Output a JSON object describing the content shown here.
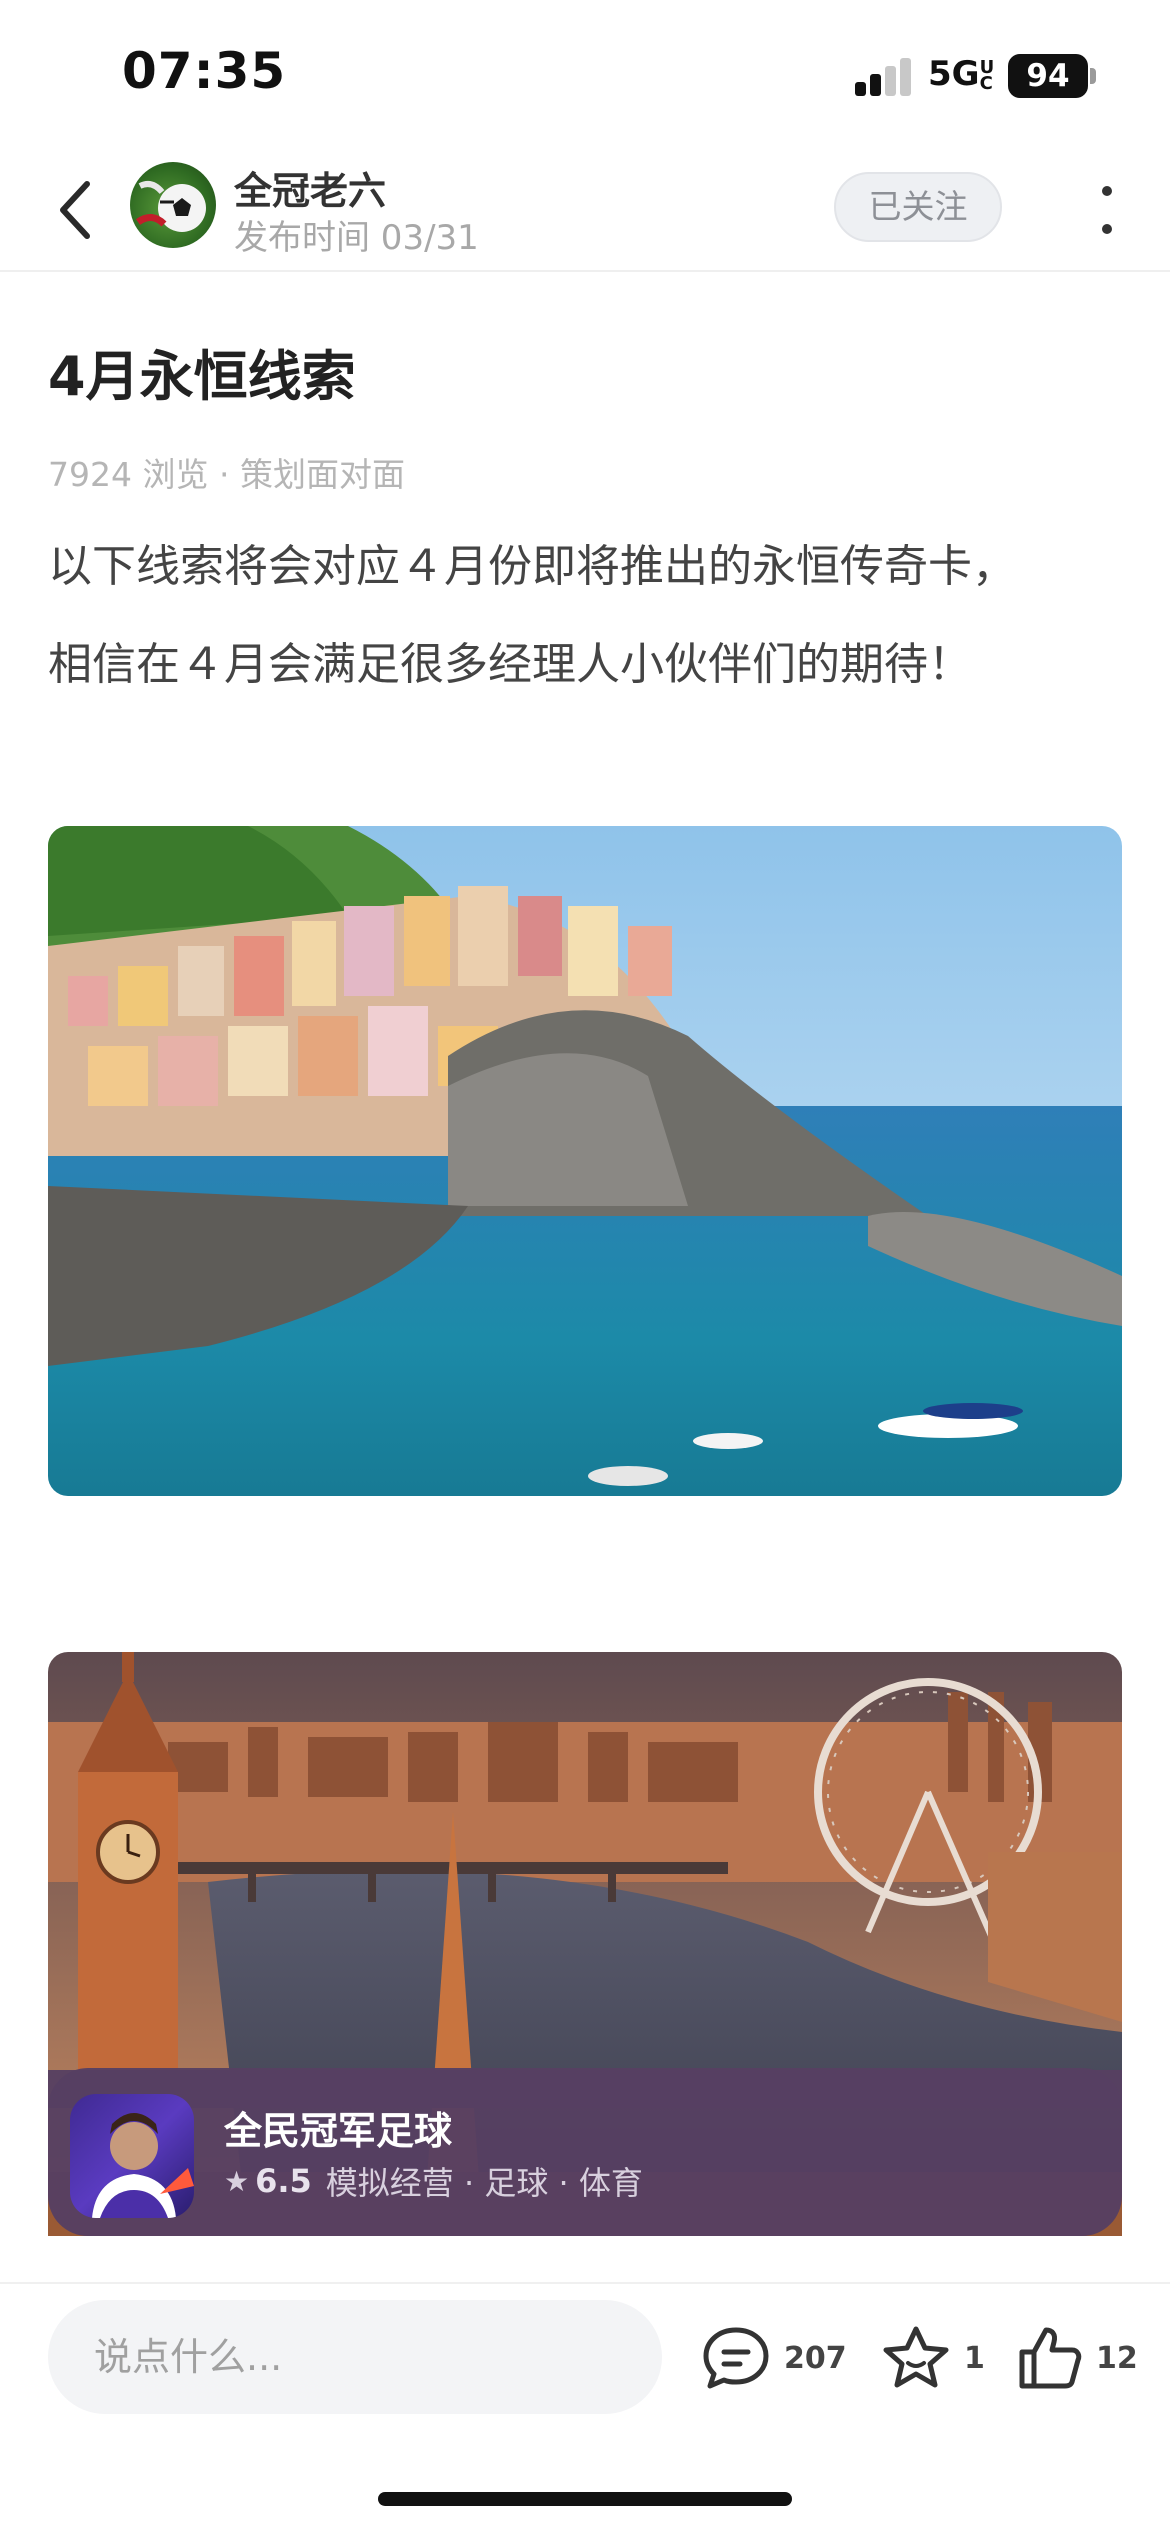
{
  "status_bar": {
    "time": "07:35",
    "network": "5G",
    "network_suffix": "UC",
    "battery": "94"
  },
  "header": {
    "author_name": "全冠老六",
    "publish_time": "发布时间 03/31",
    "follow_label": "已关注",
    "icons": [
      "back-arrow-icon",
      "more-vertical-icon"
    ]
  },
  "article": {
    "title": "4月永恒线索",
    "meta": "7924 浏览 · 策划面对面",
    "paragraph_lines": [
      "以下线索将会对应４月份即将推出的永恒传奇卡，",
      "相信在４月会满足很多经理人小伙伴们的期待！"
    ]
  },
  "game_card": {
    "name": "全民冠军足球",
    "rating": "6.5",
    "tags": "模拟经营 · 足球 · 体育"
  },
  "bottom_bar": {
    "comment_placeholder": "说点什么...",
    "comment_count": "207",
    "favorite_count": "1",
    "like_count": "12"
  },
  "colors": {
    "card_bg": "#564062",
    "follow_bg": "#eef0f3",
    "muted_text": "#a8a8a8"
  }
}
